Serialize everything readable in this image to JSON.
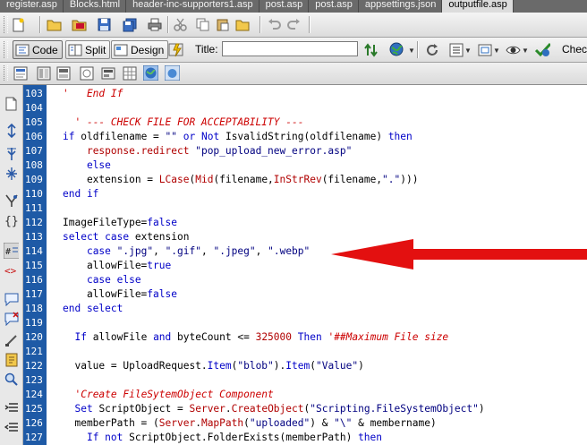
{
  "tabs": [
    "register.asp",
    "Blocks.html",
    "header-inc-supporters1.asp",
    "post.asp",
    "post.asp",
    "appsettings.json",
    "outputfile.asp"
  ],
  "active_tab_index": 6,
  "view_buttons": {
    "code": "Code",
    "split": "Split",
    "design": "Design"
  },
  "title_field": {
    "label": "Title:",
    "value": ""
  },
  "check_label": "Check",
  "accent_colors": {
    "gutter": "#1e5aa6",
    "keyword": "#0000c8",
    "comment": "#cc0000",
    "arrow": "#e31010"
  },
  "toolbar_icons": [
    "new-file-icon",
    "open-folder-icon",
    "browse-icon",
    "save-icon",
    "save-all-icon",
    "print-icon",
    "cut-icon",
    "copy-icon",
    "paste-icon",
    "folder-icon",
    "undo-icon",
    "redo-icon",
    "live-view-icon",
    "file-transfer-icon",
    "preview-globe-icon",
    "refresh-icon",
    "view-options-icon",
    "visual-aids-icon",
    "validate-icon",
    "check-browser-icon"
  ],
  "editor": {
    "lines": [
      {
        "n": "103",
        "parts": [
          [
            "cmt",
            "'   End If"
          ]
        ]
      },
      {
        "n": "104",
        "parts": [
          [
            "txt",
            ""
          ]
        ]
      },
      {
        "n": "105",
        "parts": [
          [
            "txt",
            "  "
          ],
          [
            "cmt",
            "' --- CHECK FILE FOR ACCEPTABILITY ---"
          ]
        ]
      },
      {
        "n": "106",
        "parts": [
          [
            "kw",
            "if"
          ],
          [
            "txt",
            " oldfilename = "
          ],
          [
            "str",
            "\"\""
          ],
          [
            "txt",
            " "
          ],
          [
            "kw",
            "or"
          ],
          [
            "txt",
            " "
          ],
          [
            "kw",
            "Not"
          ],
          [
            "txt",
            " IsvalidString(oldfilename) "
          ],
          [
            "kw",
            "then"
          ]
        ]
      },
      {
        "n": "107",
        "parts": [
          [
            "txt",
            "    "
          ],
          [
            "fn",
            "response.redirect"
          ],
          [
            "txt",
            " "
          ],
          [
            "str",
            "\"pop_upload_new_error.asp\""
          ]
        ]
      },
      {
        "n": "108",
        "parts": [
          [
            "txt",
            "    "
          ],
          [
            "kw",
            "else"
          ]
        ]
      },
      {
        "n": "109",
        "parts": [
          [
            "txt",
            "    extension = "
          ],
          [
            "fn",
            "LCase"
          ],
          [
            "txt",
            "("
          ],
          [
            "fn",
            "Mid"
          ],
          [
            "txt",
            "(filename,"
          ],
          [
            "fn",
            "InStrRev"
          ],
          [
            "txt",
            "(filename,"
          ],
          [
            "str",
            "\".\""
          ],
          [
            "txt",
            ")))"
          ]
        ]
      },
      {
        "n": "110",
        "parts": [
          [
            "kw",
            "end if"
          ]
        ]
      },
      {
        "n": "111",
        "parts": [
          [
            "txt",
            ""
          ]
        ]
      },
      {
        "n": "112",
        "parts": [
          [
            "txt",
            "ImageFileType="
          ],
          [
            "kw",
            "false"
          ]
        ]
      },
      {
        "n": "113",
        "parts": [
          [
            "kw",
            "select case"
          ],
          [
            "txt",
            " extension"
          ]
        ]
      },
      {
        "n": "114",
        "parts": [
          [
            "txt",
            "    "
          ],
          [
            "kw",
            "case"
          ],
          [
            "txt",
            " "
          ],
          [
            "str",
            "\".jpg\""
          ],
          [
            "txt",
            ", "
          ],
          [
            "str",
            "\".gif\""
          ],
          [
            "txt",
            ", "
          ],
          [
            "str",
            "\".jpeg\""
          ],
          [
            "txt",
            ", "
          ],
          [
            "str",
            "\".webp\""
          ]
        ]
      },
      {
        "n": "115",
        "parts": [
          [
            "txt",
            "    allowFile="
          ],
          [
            "kw",
            "true"
          ]
        ]
      },
      {
        "n": "116",
        "parts": [
          [
            "txt",
            "    "
          ],
          [
            "kw",
            "case else"
          ]
        ]
      },
      {
        "n": "117",
        "parts": [
          [
            "txt",
            "    allowFile="
          ],
          [
            "kw",
            "false"
          ]
        ]
      },
      {
        "n": "118",
        "parts": [
          [
            "kw",
            "end select"
          ]
        ]
      },
      {
        "n": "119",
        "parts": [
          [
            "txt",
            ""
          ]
        ]
      },
      {
        "n": "120",
        "parts": [
          [
            "txt",
            "  "
          ],
          [
            "kw",
            "If"
          ],
          [
            "txt",
            " allowFile "
          ],
          [
            "kw",
            "and"
          ],
          [
            "txt",
            " byteCount <= "
          ],
          [
            "fn",
            "325000"
          ],
          [
            "txt",
            " "
          ],
          [
            "kw",
            "Then"
          ],
          [
            "txt",
            " "
          ],
          [
            "cmt",
            "'##Maximum File size"
          ]
        ]
      },
      {
        "n": "121",
        "parts": [
          [
            "txt",
            ""
          ]
        ]
      },
      {
        "n": "122",
        "parts": [
          [
            "txt",
            "  value = UploadRequest."
          ],
          [
            "kw",
            "Item"
          ],
          [
            "txt",
            "("
          ],
          [
            "str",
            "\"blob\""
          ],
          [
            "txt",
            ")."
          ],
          [
            "kw",
            "Item"
          ],
          [
            "txt",
            "("
          ],
          [
            "str",
            "\"Value\""
          ],
          [
            "txt",
            ")"
          ]
        ]
      },
      {
        "n": "123",
        "parts": [
          [
            "txt",
            ""
          ]
        ]
      },
      {
        "n": "124",
        "parts": [
          [
            "txt",
            "  "
          ],
          [
            "cmt",
            "'Create FileSytemObject Component"
          ]
        ]
      },
      {
        "n": "125",
        "parts": [
          [
            "txt",
            "  "
          ],
          [
            "kw",
            "Set"
          ],
          [
            "txt",
            " ScriptObject = "
          ],
          [
            "fn",
            "Server"
          ],
          [
            "txt",
            "."
          ],
          [
            "fn",
            "CreateObject"
          ],
          [
            "txt",
            "("
          ],
          [
            "str",
            "\"Scripting.FileSystemObject\""
          ],
          [
            "txt",
            ")"
          ]
        ]
      },
      {
        "n": "126",
        "parts": [
          [
            "txt",
            "  memberPath = ("
          ],
          [
            "fn",
            "Server"
          ],
          [
            "txt",
            "."
          ],
          [
            "fn",
            "MapPath"
          ],
          [
            "txt",
            "("
          ],
          [
            "str",
            "\"uploaded\""
          ],
          [
            "txt",
            ") & "
          ],
          [
            "str",
            "\"\\\""
          ],
          [
            "txt",
            " & membername)"
          ]
        ]
      },
      {
        "n": "127",
        "parts": [
          [
            "txt",
            "    "
          ],
          [
            "kw",
            "If not"
          ],
          [
            "txt",
            " ScriptObject.FolderExists(memberPath) "
          ],
          [
            "kw",
            "then"
          ]
        ]
      }
    ]
  }
}
